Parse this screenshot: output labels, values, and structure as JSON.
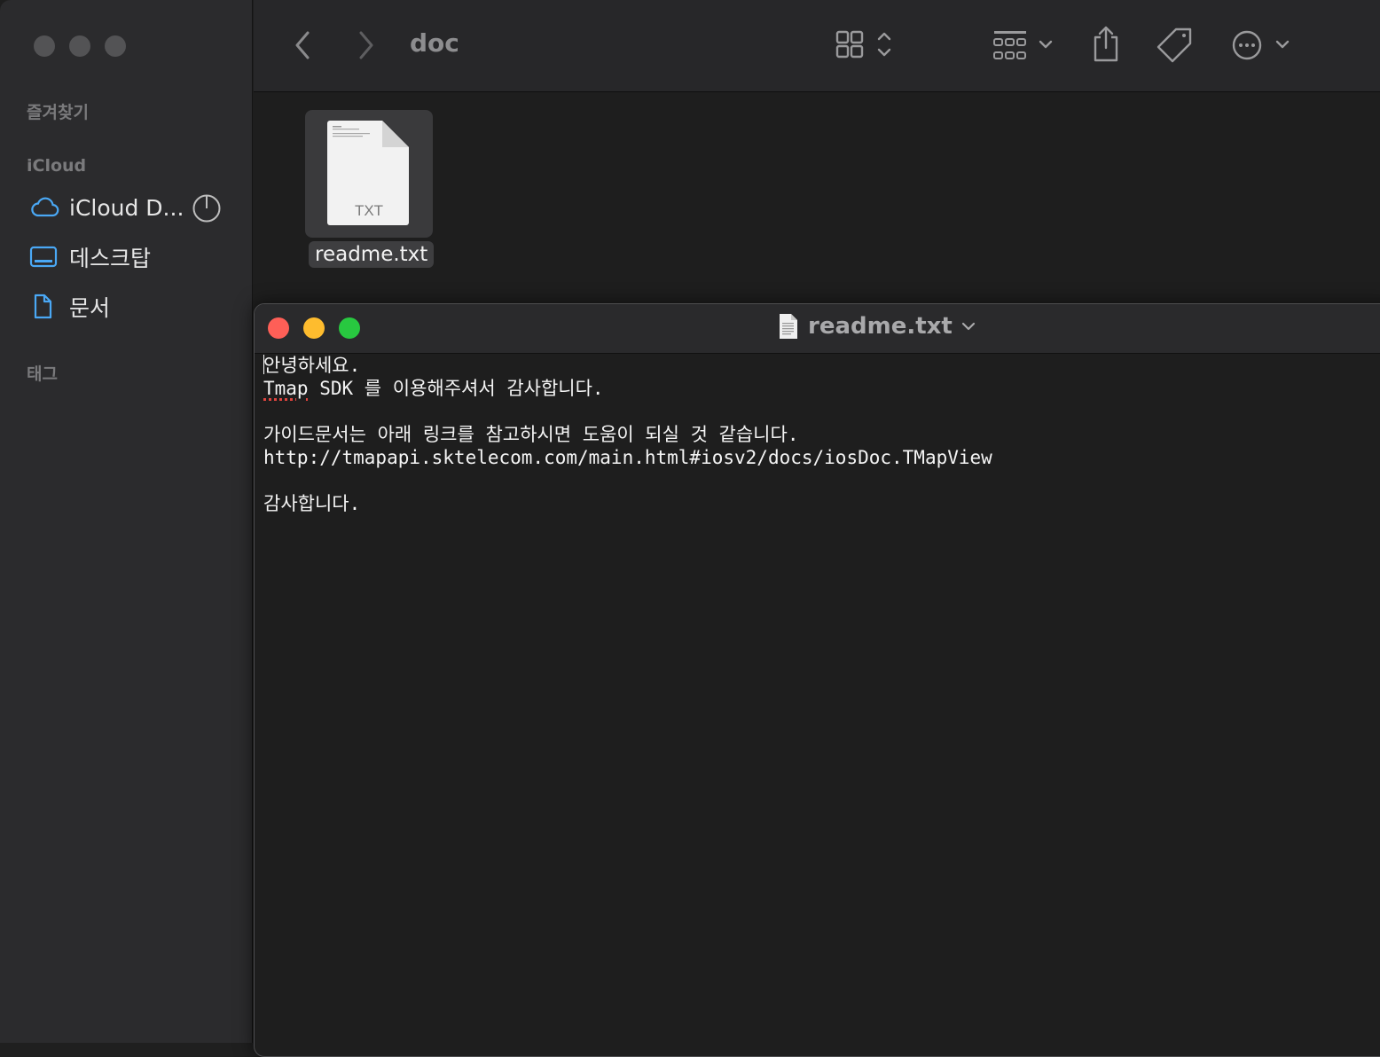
{
  "finder": {
    "path_title": "doc",
    "sidebar": {
      "favorites_header": "즐겨찾기",
      "icloud_header": "iCloud",
      "items": [
        {
          "label": "iCloud D...",
          "icon": "icloud-icon"
        },
        {
          "label": "데스크탑",
          "icon": "desktop-icon"
        },
        {
          "label": "문서",
          "icon": "document-icon"
        }
      ],
      "tags_header": "태그"
    },
    "files": [
      {
        "name": "readme.txt",
        "badge": "TXT"
      }
    ]
  },
  "textedit": {
    "window_title": "readme.txt",
    "lines": [
      "안녕하세요.",
      "Tmap SDK 를 이용해주셔서 감사합니다.",
      "",
      "가이드문서는 아래 링크를 참고하시면 도움이 되실 것 같습니다.",
      "http://tmapapi.sktelecom.com/main.html#iosv2/docs/iosDoc.TMapView",
      "",
      "감사합니다."
    ],
    "line2_word1": "Tmap",
    "line2_rest": " SDK 를 이용해주셔서 감사합니다.",
    "line1_first": "안",
    "line1_rest": "녕하세요."
  },
  "colors": {
    "close": "#fe5f57",
    "minimize": "#febc2e",
    "zoom": "#28c840",
    "sidebar_icon": "#4aa8f5"
  }
}
